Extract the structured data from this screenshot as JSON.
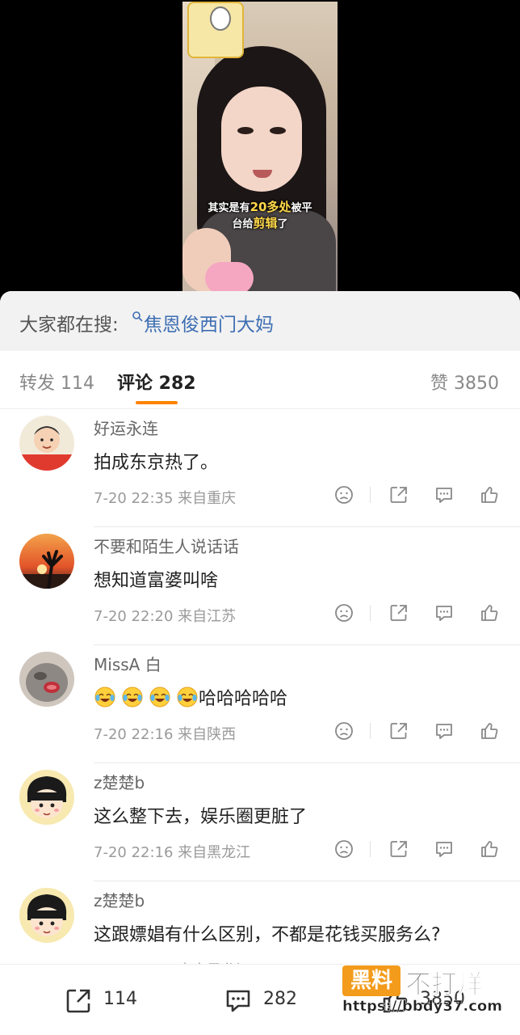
{
  "video": {
    "caption_line1_a": "其实是有",
    "caption_line1_b": "20多处",
    "caption_line1_c": "被平",
    "caption_line2_a": "台给",
    "caption_line2_b": "剪辑",
    "caption_line2_c": "了"
  },
  "search": {
    "label": "大家都在搜:",
    "term": "焦恩俊西门大妈",
    "icon": "search-icon"
  },
  "tabs": {
    "repost": "转发 114",
    "comment": "评论 282",
    "like": "赞 3850",
    "accent": "#ff8200"
  },
  "comments": [
    {
      "name": "好运永连",
      "text": "拍成东京热了。",
      "meta": "7-20 22:35 来自重庆"
    },
    {
      "name": "不要和陌生人说话话",
      "text": "想知道富婆叫啥",
      "meta": "7-20 22:20 来自江苏"
    },
    {
      "name": "MissA 白",
      "text": "哈哈哈哈哈",
      "meta": "7-20 22:16 来自陕西"
    },
    {
      "name": "z楚楚b",
      "text": "这么整下去，娱乐圈更脏了",
      "meta": "7-20 22:16 来自黑龙江"
    },
    {
      "name": "z楚楚b",
      "text": "这跟嫖娼有什么区别，不都是花钱买服务么?",
      "meta": "7-20 22:15 来自黑龙江"
    }
  ],
  "bottom": {
    "repost_count": "114",
    "comment_count": "282",
    "like_count": "3850"
  },
  "watermark": {
    "box": "黑料",
    "text": "不打烊",
    "url": "https://bbdy37.com"
  }
}
